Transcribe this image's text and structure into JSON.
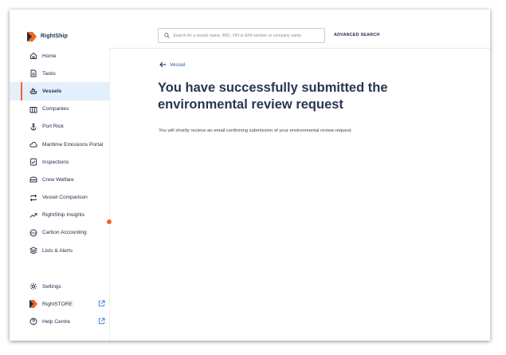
{
  "brand": {
    "name": "RightShip"
  },
  "header": {
    "search_placeholder": "Search for a vessel name, IMO, VIN or ENI number or company name",
    "advanced_search": "ADVANCED SEARCH"
  },
  "sidebar": {
    "items": [
      {
        "label": "Home",
        "icon": "home-icon"
      },
      {
        "label": "Tasks",
        "icon": "tasks-icon"
      },
      {
        "label": "Vessels",
        "icon": "ship-icon",
        "active": true
      },
      {
        "label": "Companies",
        "icon": "building-icon"
      },
      {
        "label": "Port Risk",
        "icon": "anchor-icon"
      },
      {
        "label": "Maritime Emissions Portal",
        "icon": "cloud-icon"
      },
      {
        "label": "Inspections",
        "icon": "inspection-icon"
      },
      {
        "label": "Crew Welfare",
        "icon": "crew-icon"
      },
      {
        "label": "Vessel Comparison",
        "icon": "compare-icon"
      },
      {
        "label": "RightShip Insights",
        "icon": "trend-icon"
      },
      {
        "label": "Carbon Accounting",
        "icon": "co2-icon"
      },
      {
        "label": "Lists & Alerts",
        "icon": "layers-icon"
      }
    ],
    "bottom_items": [
      {
        "label": "Settings",
        "icon": "gear-icon"
      },
      {
        "label": "RightSTORE",
        "icon": "rightship-logo-icon",
        "external": true
      },
      {
        "label": "Help Centre",
        "icon": "help-icon",
        "external": true
      }
    ],
    "accent_color": "#f26722"
  },
  "main": {
    "back_label": "Vessel",
    "title": "You have successfully submitted the environmental review request",
    "message": "You will shortly recieve an email confirming submission of your environmental review request."
  }
}
